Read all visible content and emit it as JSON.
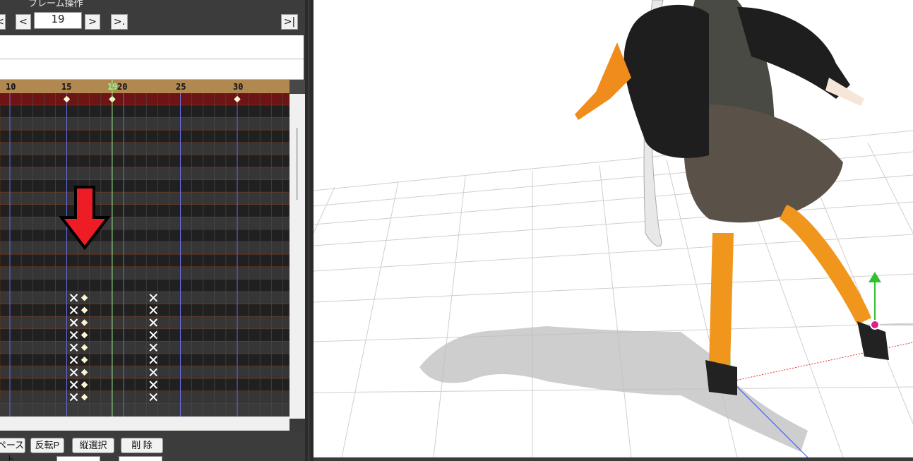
{
  "frame_panel": {
    "title": "フレーム操作",
    "current_frame": "19",
    "buttons": {
      "first": "<",
      "prev": "<",
      "next": ">",
      "next_key": ">.",
      "last": ">|"
    }
  },
  "timeline": {
    "ruler_labels": [
      "10",
      "15",
      "19",
      "20",
      "25",
      "30"
    ],
    "current_frame": 19,
    "ruler_color": "#b08850",
    "current_line_color": "#9ef08a",
    "summary_row_color": "#6e1414",
    "keyframes_summary": [
      15,
      19,
      30
    ],
    "keyframes_diamond": [
      16
    ],
    "keyframes_cross": [
      15,
      22
    ],
    "overlay_arrow": "down-arrow",
    "overlay_arrow_color": "#ee1c24"
  },
  "bottom_toolbar": {
    "paste_label": "ペースト",
    "flip_paste_label": "反転P",
    "vertical_select_label": "縦選択",
    "delete_label": "削 除"
  },
  "viewport": {
    "floor_grid": true,
    "gizmo_axes": [
      "x-axis",
      "y-axis",
      "z-axis"
    ],
    "axis_colors": {
      "x": "#e03030",
      "y": "#30c030",
      "z": "#3050e0"
    }
  }
}
